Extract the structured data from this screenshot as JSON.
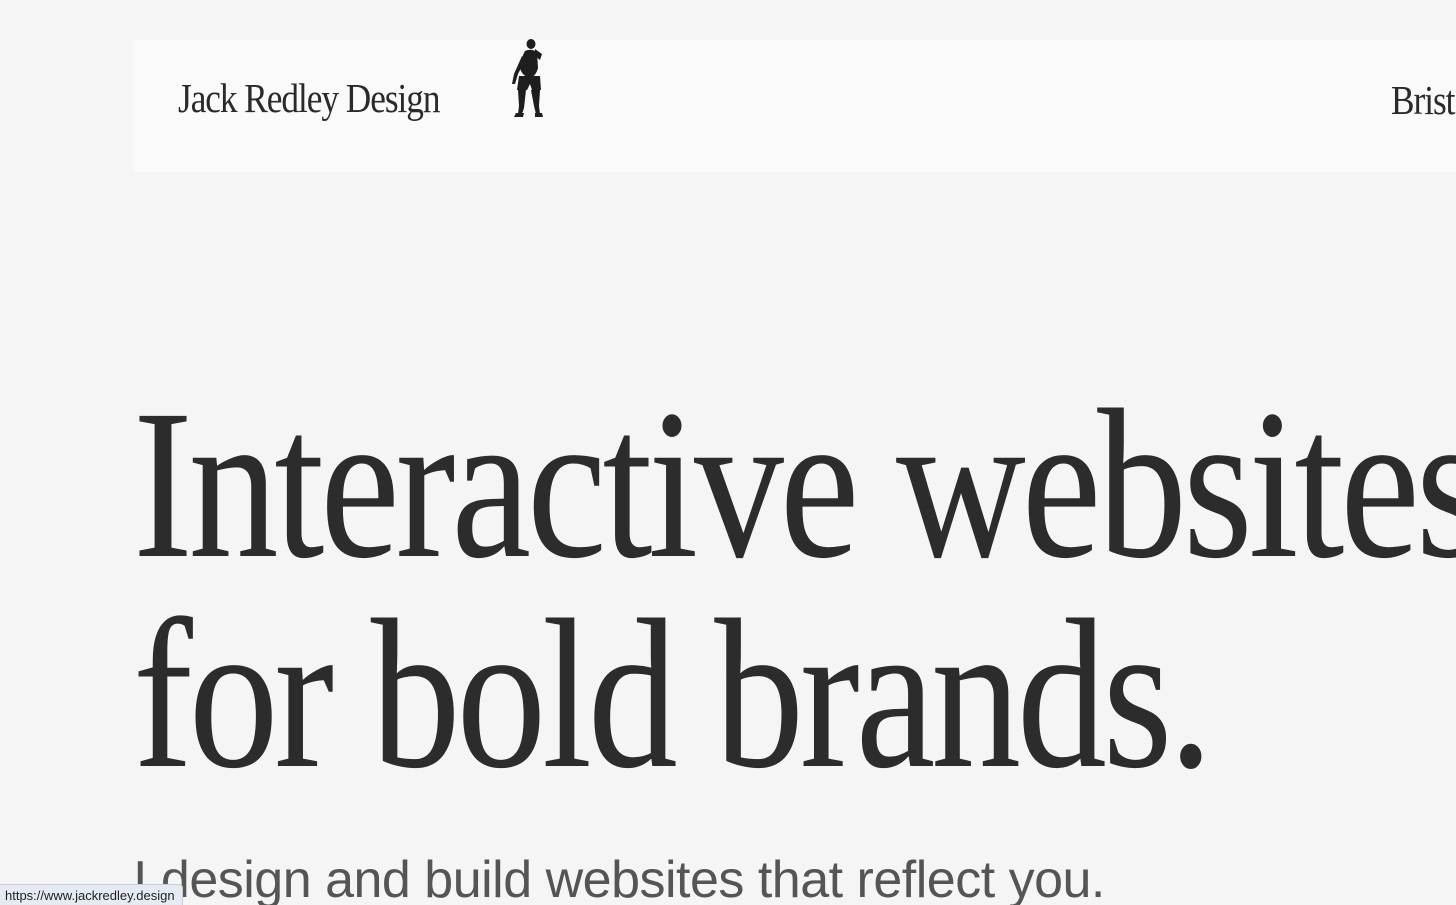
{
  "header": {
    "logo_text": "Jack Redley Design",
    "logo_icon": "dancer-figure-icon",
    "location_text": "Brist"
  },
  "hero": {
    "line1": "Interactive websites",
    "line2": "for bold brands."
  },
  "subhead": "I design and build websites that reflect you.",
  "status_bar": {
    "url": "https://www.jackredley.design"
  },
  "colors": {
    "background": "#f5f5f5",
    "header_background": "#fafafa",
    "text": "#2b2b2b",
    "subhead_text": "#555555"
  }
}
